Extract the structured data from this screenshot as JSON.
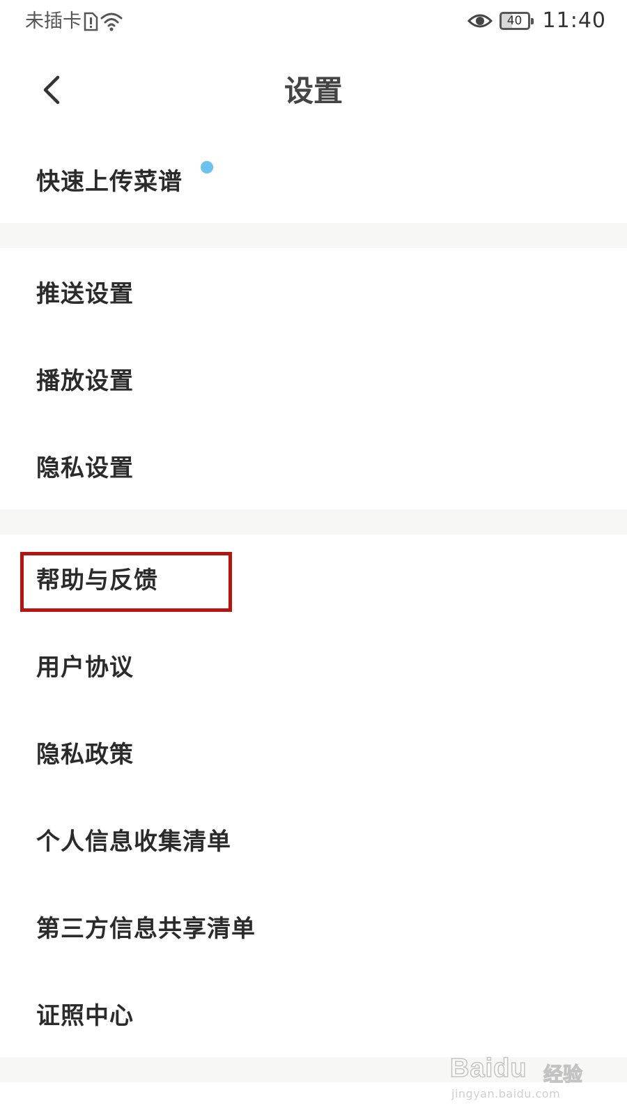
{
  "status_bar": {
    "carrier": "未插卡",
    "time": "11:40",
    "battery_level": "40",
    "battery_fraction": 0.4,
    "icons": [
      "sim-alert-icon",
      "wifi-icon",
      "eye-icon",
      "battery-icon"
    ]
  },
  "header": {
    "title": "设置",
    "back_icon": "chevron-left-icon"
  },
  "groups": [
    {
      "items": [
        {
          "label": "快速上传菜谱",
          "has_new_dot": true
        }
      ]
    },
    {
      "items": [
        {
          "label": "推送设置"
        },
        {
          "label": "播放设置"
        },
        {
          "label": "隐私设置"
        }
      ]
    },
    {
      "items": [
        {
          "label": "帮助与反馈",
          "highlighted": true
        },
        {
          "label": "用户协议"
        },
        {
          "label": "隐私政策"
        },
        {
          "label": "个人信息收集清单"
        },
        {
          "label": "第三方信息共享清单"
        },
        {
          "label": "证照中心"
        }
      ]
    }
  ],
  "colors": {
    "highlight_border": "#b5140f",
    "new_dot": "#6cc4ec",
    "group_gap": "#f7f7f6"
  },
  "watermark": {
    "brand": "Baidu",
    "suffix": "经验",
    "url": "jingyan.baidu.com"
  }
}
